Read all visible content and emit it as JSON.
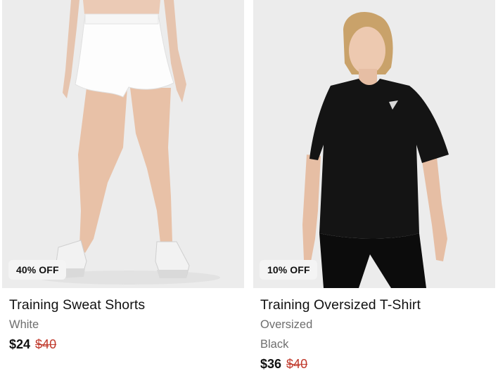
{
  "products": [
    {
      "badge": "40% OFF",
      "name": "Training Sweat Shorts",
      "variants": [
        "White"
      ],
      "sale_price": "$24",
      "original_price": "$40"
    },
    {
      "badge": "10% OFF",
      "name": "Training Oversized T-Shirt",
      "variants": [
        "Oversized",
        "Black"
      ],
      "sale_price": "$36",
      "original_price": "$40"
    }
  ],
  "colors": {
    "image_bg": "#ececec",
    "badge_bg": "#f4f4f4",
    "strike_price": "#c0392b",
    "muted_text": "#6e6e6e"
  }
}
